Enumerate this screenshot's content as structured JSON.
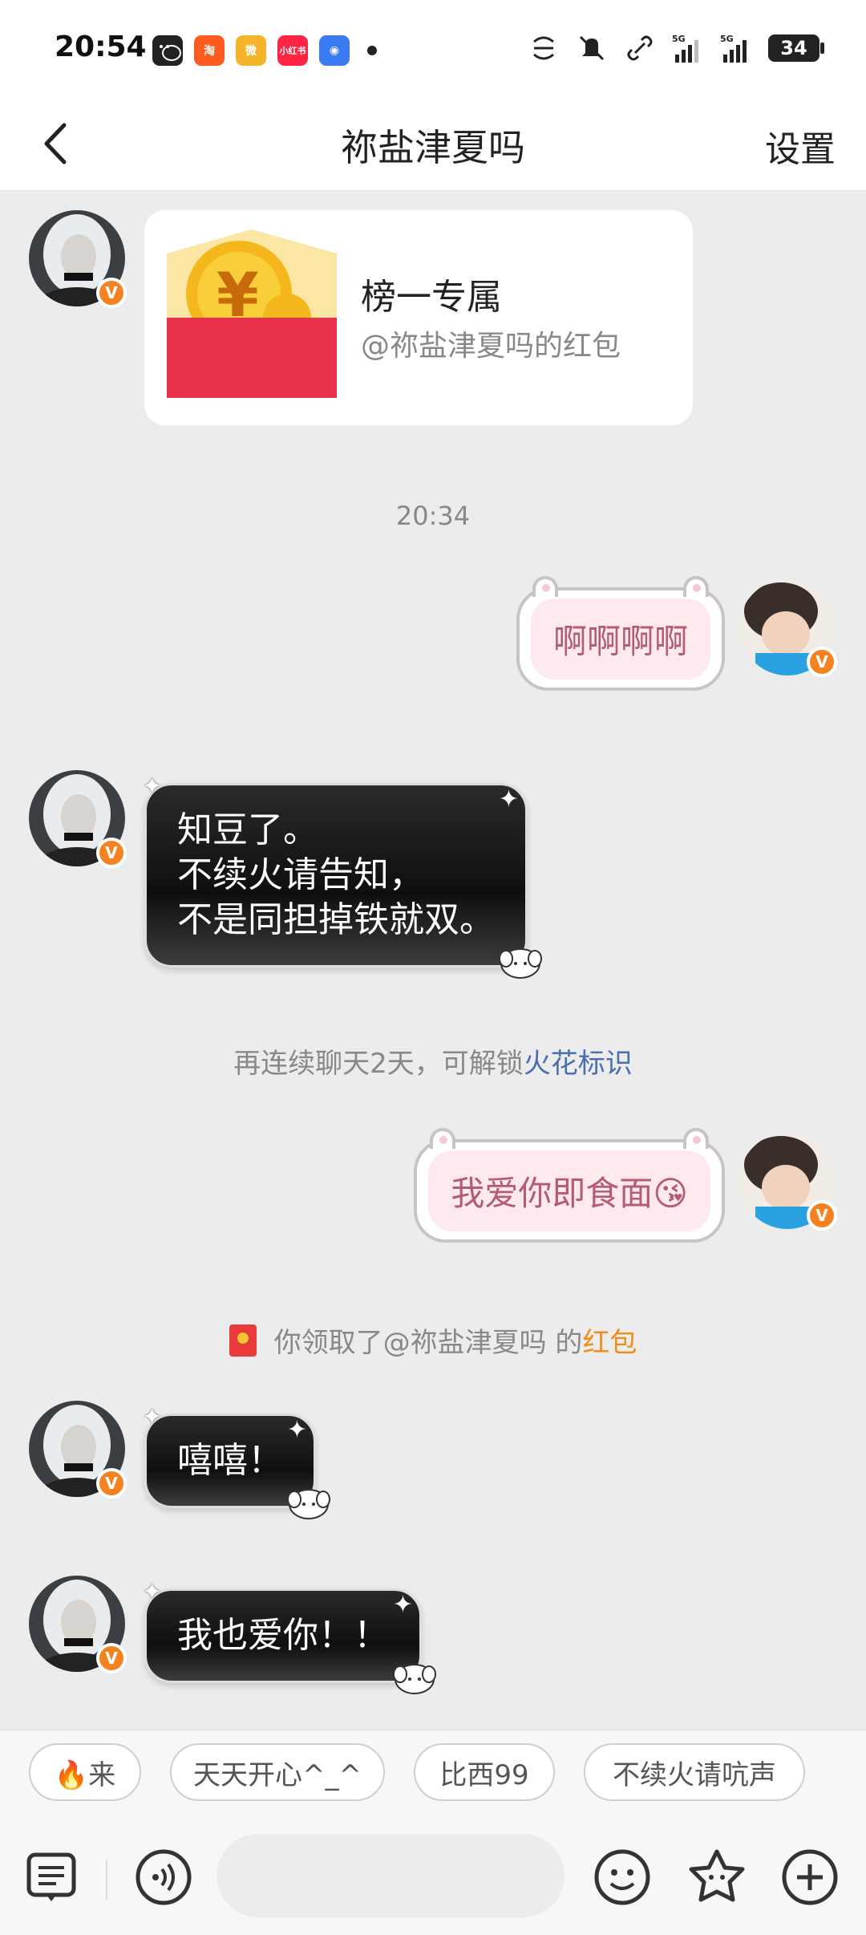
{
  "status_bar": {
    "time": "20:54",
    "app_icons": [
      "wechat-icon",
      "taobao-icon",
      "weibo-icon",
      "xiaohongshu-icon",
      "app-icon"
    ],
    "battery": "34",
    "network": [
      "5G",
      "5G"
    ]
  },
  "header": {
    "title": "祢盐津夏吗",
    "settings_label": "设置"
  },
  "messages": {
    "red_packet": {
      "title": "榜一专属",
      "subtitle": "@祢盐津夏吗的红包"
    },
    "time_sep": "20:34",
    "sent_1": "啊啊啊啊",
    "recv_1": [
      "知豆了。",
      "不续火请告知，",
      "不是同担掉铁就双。"
    ],
    "system_1": {
      "text": "再连续聊天2天，可解锁",
      "link": "火花标识"
    },
    "sent_2": "我爱你即食面😘",
    "system_2": {
      "text": "你领取了@祢盐津夏吗 的",
      "highlight": "红包"
    },
    "recv_2": "嘻嘻！",
    "recv_3": "我也爱你！！"
  },
  "quick_replies": [
    "🔥来",
    "天天开心^_^",
    "比西99",
    "不续火请吭声"
  ],
  "input_bar": {
    "placeholder": "",
    "icons": [
      "menu-icon",
      "voice-icon",
      "emoji-icon",
      "sticker-icon",
      "plus-icon"
    ]
  },
  "colors": {
    "accent_orange": "#f58220",
    "link_blue": "#4a6fb0",
    "pink_text": "#b35c72"
  }
}
